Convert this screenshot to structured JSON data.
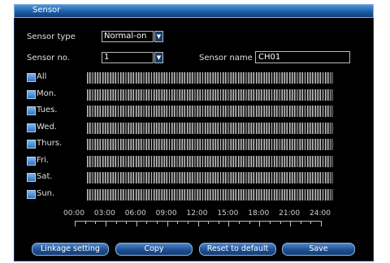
{
  "window": {
    "title": "Sensor"
  },
  "form": {
    "sensor_type_label": "Sensor type",
    "sensor_type_value": "Normal-on",
    "sensor_no_label": "Sensor no.",
    "sensor_no_value": "1",
    "sensor_name_label": "Sensor name",
    "sensor_name_value": "CH01"
  },
  "schedule": {
    "days": [
      {
        "label": "All",
        "checked": true,
        "active_fraction": 1.0
      },
      {
        "label": "Mon.",
        "checked": true,
        "active_fraction": 1.0
      },
      {
        "label": "Tues.",
        "checked": true,
        "active_fraction": 1.0
      },
      {
        "label": "Wed.",
        "checked": true,
        "active_fraction": 1.0
      },
      {
        "label": "Thurs.",
        "checked": true,
        "active_fraction": 1.0
      },
      {
        "label": "Fri.",
        "checked": true,
        "active_fraction": 1.0
      },
      {
        "label": "Sat.",
        "checked": true,
        "active_fraction": 1.0
      },
      {
        "label": "Sun.",
        "checked": true,
        "active_fraction": 1.0
      }
    ],
    "time_ticks": [
      "00:00",
      "03:00",
      "06:00",
      "09:00",
      "12:00",
      "15:00",
      "18:00",
      "21:00",
      "24:00"
    ]
  },
  "buttons": {
    "linkage": "Linkage setting",
    "copy": "Copy",
    "reset": "Reset to default",
    "save": "Save"
  },
  "colors": {
    "title_bar": "#1d5ea8",
    "panel_bg": "#000000",
    "schedule_slot": "#bdbdbd",
    "checkbox": "#3b7fd0"
  },
  "icons": {
    "dropdown": "chevron-down-icon",
    "checkbox": "checkbox-checked-icon"
  }
}
